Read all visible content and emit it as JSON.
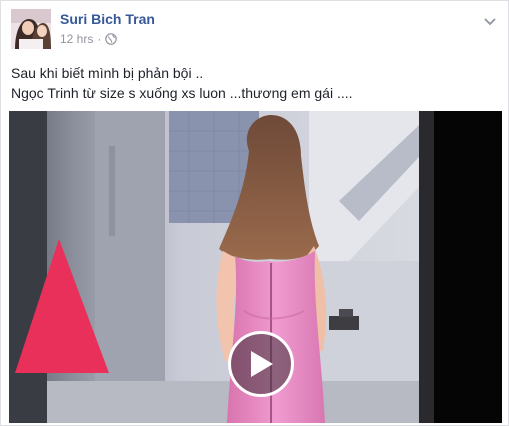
{
  "post": {
    "author": "Suri Bich Tran",
    "timestamp": "12 hrs",
    "separator": "·",
    "audience_icon": "globe-icon",
    "menu_icon": "chevron-down-icon",
    "text_lines": [
      "Sau khi biết mình bị phản bội ..",
      "Ngọc Trinh từ size s xuống xs luon ...thương em gái ...."
    ]
  },
  "video": {
    "play_icon": "play-icon"
  },
  "colors": {
    "author_link": "#365899",
    "meta_text": "#90949c",
    "body_text": "#1d2129",
    "dress_pink": "#e58ac0",
    "triangle_red": "#e8305a"
  }
}
